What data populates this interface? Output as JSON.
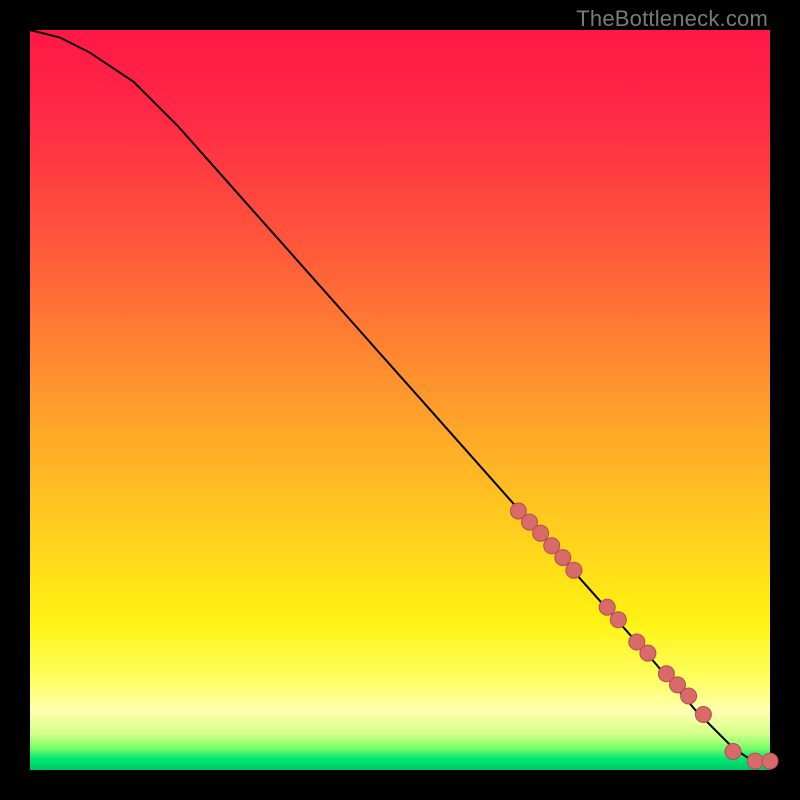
{
  "watermark": "TheBottleneck.com",
  "colors": {
    "curve_stroke": "#000000",
    "marker_fill": "#d86a6a",
    "marker_stroke": "#b24f4f"
  },
  "chart_data": {
    "type": "line",
    "title": "",
    "xlabel": "",
    "ylabel": "",
    "xlim": [
      0,
      100
    ],
    "ylim": [
      0,
      100
    ],
    "grid": false,
    "legend": false,
    "series": [
      {
        "name": "curve",
        "x": [
          0,
          4,
          8,
          14,
          20,
          28,
          36,
          44,
          52,
          60,
          68,
          76,
          84,
          90,
          95,
          98,
          100
        ],
        "y": [
          100,
          99,
          97,
          93,
          87,
          78,
          69,
          60,
          51,
          42,
          33,
          24,
          15,
          8,
          3,
          1,
          1
        ]
      }
    ],
    "markers": {
      "name": "points",
      "x": [
        66,
        67.5,
        69,
        70.5,
        72,
        73.5,
        78,
        79.5,
        82,
        83.5,
        86,
        87.5,
        89,
        91,
        95,
        98,
        100
      ],
      "y": [
        35,
        33.5,
        32,
        30.3,
        28.7,
        27,
        22,
        20.3,
        17.3,
        15.8,
        13,
        11.5,
        10,
        7.5,
        2.5,
        1.2,
        1.2
      ]
    }
  }
}
